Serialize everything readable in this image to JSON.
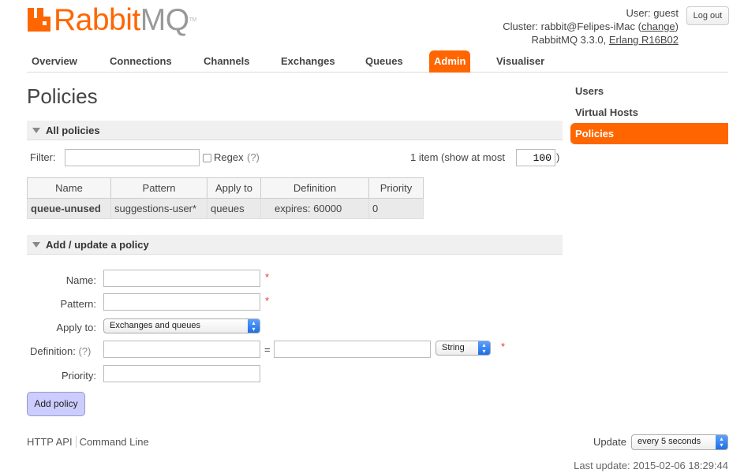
{
  "brand": {
    "name_part1": "Rabbit",
    "name_part2": "MQ",
    "trademark": "TM",
    "color": "#ff6600"
  },
  "header": {
    "user_label": "User:",
    "user": "guest",
    "cluster_label": "Cluster:",
    "cluster": "rabbit@Felipes-iMac",
    "change_link": "change",
    "version": "RabbitMQ 3.3.0,",
    "erlang": "Erlang R16B02",
    "logout": "Log out"
  },
  "nav": {
    "items": [
      "Overview",
      "Connections",
      "Channels",
      "Exchanges",
      "Queues",
      "Admin",
      "Visualiser"
    ],
    "active": "Admin"
  },
  "page_title": "Policies",
  "sidebar": {
    "items": [
      "Users",
      "Virtual Hosts",
      "Policies"
    ],
    "active": "Policies"
  },
  "all_policies": {
    "header": "All policies",
    "filter_label": "Filter:",
    "filter_value": "",
    "regex_label": "Regex",
    "regex_help": "(?)",
    "regex_checked": false,
    "count_text": "1 item (show at most",
    "show_at_most": "100",
    "count_close": ")",
    "columns": [
      "Name",
      "Pattern",
      "Apply to",
      "Definition",
      "Priority"
    ],
    "rows": [
      {
        "name": "queue-unused",
        "pattern": "suggestions-user*",
        "apply_to": "queues",
        "definition": "expires: 60000",
        "priority": "0"
      }
    ]
  },
  "add_policy": {
    "header": "Add / update a policy",
    "name_label": "Name:",
    "pattern_label": "Pattern:",
    "apply_label": "Apply to:",
    "apply_value": "Exchanges and queues",
    "definition_label": "Definition:",
    "definition_help": "(?)",
    "equals": "=",
    "type_value": "String",
    "priority_label": "Priority:",
    "required_mark": "*",
    "submit": "Add policy"
  },
  "footer": {
    "links": [
      "HTTP API",
      "Command Line"
    ],
    "update_label": "Update",
    "update_value": "every 5 seconds",
    "last_update": "Last update: 2015-02-06 18:29:44"
  }
}
